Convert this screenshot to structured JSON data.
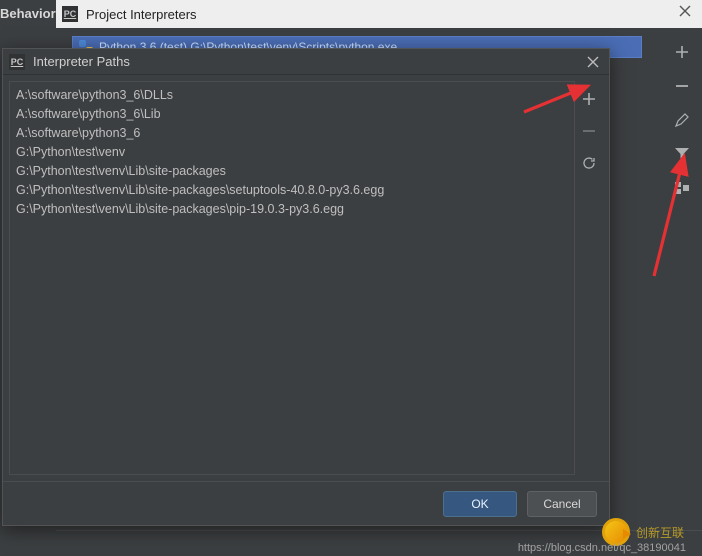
{
  "parent": {
    "title": "Project Interpreters",
    "left_label": "Behavior",
    "interpreter_row": "Python 3.6 (test)  G:\\Python\\test\\venv\\Scripts\\python.exe"
  },
  "right_toolbar": {
    "add": "+",
    "remove": "−",
    "edit": "pencil-icon",
    "filter": "filter-icon",
    "tree": "tree-icon"
  },
  "dialog": {
    "title": "Interpreter Paths",
    "paths": [
      "A:\\software\\python3_6\\DLLs",
      "A:\\software\\python3_6\\Lib",
      "A:\\software\\python3_6",
      "G:\\Python\\test\\venv",
      "G:\\Python\\test\\venv\\Lib\\site-packages",
      "G:\\Python\\test\\venv\\Lib\\site-packages\\setuptools-40.8.0-py3.6.egg",
      "G:\\Python\\test\\venv\\Lib\\site-packages\\pip-19.0.3-py3.6.egg"
    ],
    "list_toolbar": {
      "add": "+",
      "remove": "−",
      "reload": "reload-icon"
    },
    "ok_label": "OK",
    "cancel_label": "Cancel"
  },
  "watermark": {
    "text": "创新互联",
    "url": "https://blog.csdn.net/qc_38190041"
  }
}
